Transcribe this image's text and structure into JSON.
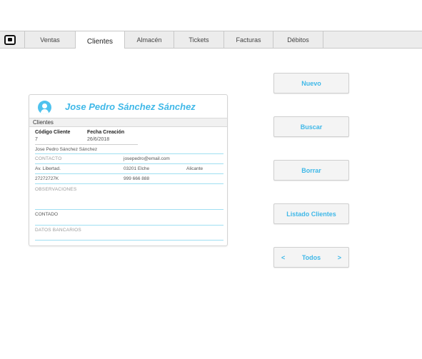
{
  "nav": {
    "tabs": [
      {
        "label": "Ventas",
        "active": false
      },
      {
        "label": "Clientes",
        "active": true
      },
      {
        "label": "Almacén",
        "active": false
      },
      {
        "label": "Tickets",
        "active": false
      },
      {
        "label": "Facturas",
        "active": false
      },
      {
        "label": "Débitos",
        "active": false
      }
    ]
  },
  "client": {
    "name": "Jose Pedro Sánchez Sánchez",
    "section_label": "Clientes",
    "code_label": "Código Cliente",
    "code_value": "7",
    "date_label": "Fecha Creación",
    "date_value": "26/6/2018",
    "full_name": "Jose Pedro Sánchez Sánchez",
    "contact_placeholder": "CONTACTO",
    "email": "josepedro@email.com",
    "address": "Av. Libertad.",
    "postal_city": "03201  Elche",
    "province": "Alicante",
    "tax_id": "27272727K",
    "phone": "999 666 888",
    "observations_placeholder": "OBSERVACIONES",
    "payment": "CONTADO",
    "bank_placeholder": "DATOS BANCARIOS"
  },
  "actions": {
    "new_label": "Nuevo",
    "search_label": "Buscar",
    "delete_label": "Borrar",
    "list_label": "Listado Clientes",
    "prev_label": "<",
    "all_label": "Todos",
    "next_label": ">"
  },
  "colors": {
    "accent": "#3fb8e8",
    "nav_bg": "#ececec"
  }
}
